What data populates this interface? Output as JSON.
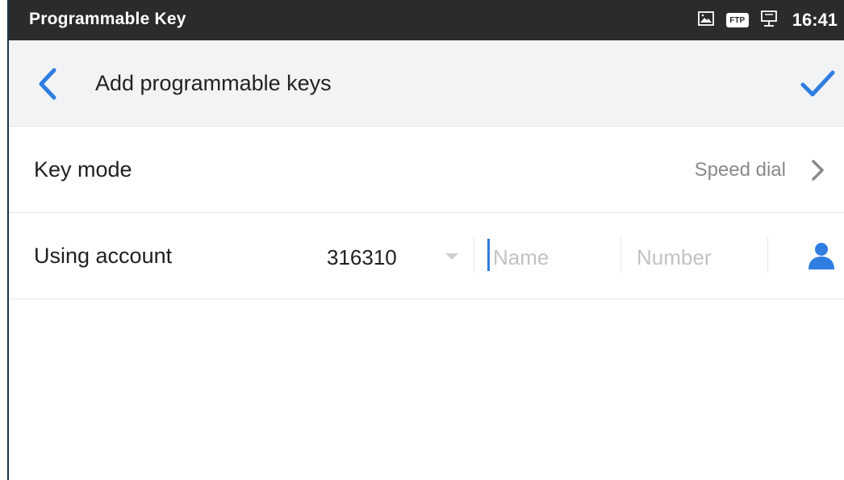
{
  "statusbar": {
    "title": "Programmable Key",
    "time": "16:41",
    "ftp_badge": "FTP",
    "icons": [
      "screenshot-icon",
      "ftp-icon",
      "network-icon"
    ]
  },
  "appbar": {
    "title": "Add programmable keys",
    "icons": [
      "back-arrow-icon",
      "check-icon"
    ]
  },
  "key_mode": {
    "label": "Key mode",
    "value": "Speed dial"
  },
  "using_account": {
    "label": "Using account",
    "account": "316310",
    "name_placeholder": "Name",
    "number_placeholder": "Number",
    "contact_icon": "person-icon"
  },
  "colors": {
    "accent": "#2f7de1",
    "statusbar_bg": "#2b2b2b",
    "appbar_bg": "#f2f3f4"
  }
}
